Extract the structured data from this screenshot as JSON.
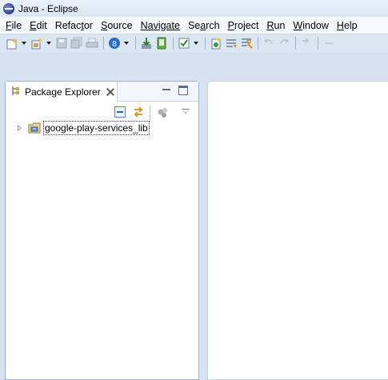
{
  "window": {
    "title": "Java - Eclipse"
  },
  "menubar": {
    "items": [
      {
        "mnemonic": "F",
        "rest": "ile"
      },
      {
        "mnemonic": "E",
        "rest": "dit"
      },
      {
        "prefix": "Refac",
        "mnemonic": "t",
        "rest": "or"
      },
      {
        "mnemonic": "S",
        "rest": "ource"
      },
      {
        "prefix": "Navigate",
        "mnemonic": "",
        "rest": ""
      },
      {
        "prefix": "Se",
        "mnemonic": "a",
        "rest": "rch"
      },
      {
        "mnemonic": "P",
        "rest": "roject"
      },
      {
        "mnemonic": "R",
        "rest": "un"
      },
      {
        "mnemonic": "W",
        "rest": "indow"
      },
      {
        "mnemonic": "H",
        "rest": "elp"
      }
    ]
  },
  "toolbar": {
    "icons": [
      "new-wizard-icon",
      "new-package-icon",
      "save-icon",
      "save-all-icon",
      "print-icon",
      "android-sdk-icon",
      "android-avd-icon",
      "run-checkbox-icon",
      "new-java-class-icon",
      "task-list-icon",
      "open-type-icon",
      "back-icon",
      "forward-icon",
      "next-edit-icon"
    ]
  },
  "package_explorer": {
    "tab_label": "Package Explorer",
    "tree": [
      {
        "label": "google-play-services_lib",
        "expanded": false,
        "selected": true
      }
    ]
  },
  "colors": {
    "chrome": "#d6e2f0",
    "view_background": "#ffffff",
    "view_border": "#9ab0cc"
  }
}
